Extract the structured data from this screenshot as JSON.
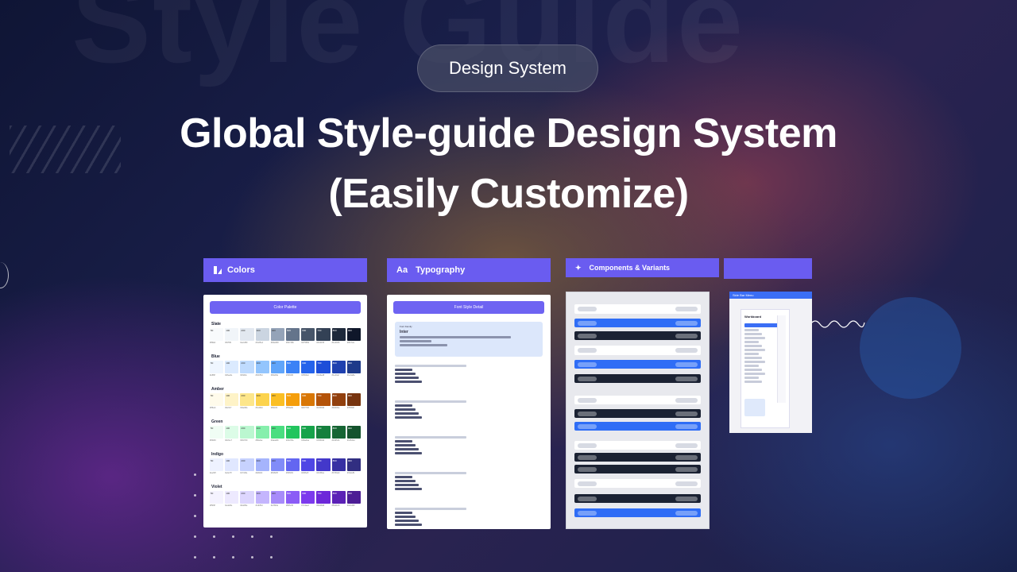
{
  "background_word": "Style Guide",
  "badge": {
    "label": "Design System"
  },
  "headline": {
    "line1": "Global Style-guide Design System",
    "line2": "(Easily Customize)"
  },
  "tabs": [
    {
      "label": "Colors",
      "icon": "palette-icon"
    },
    {
      "label": "Typography",
      "icon": "typography-icon",
      "icon_text": "Aa"
    },
    {
      "label": "Components & Variants",
      "icon": "components-icon"
    },
    {
      "label": "",
      "icon": ""
    }
  ],
  "colors_card": {
    "header": "Color Palette",
    "groups": [
      {
        "name": "Slate",
        "steps": [
          "50",
          "100",
          "200",
          "300",
          "400",
          "500",
          "600",
          "700",
          "800",
          "900"
        ],
        "colors": [
          "#f8fafc",
          "#f1f5f9",
          "#e2e8f0",
          "#cbd5e1",
          "#94a3b8",
          "#64748b",
          "#475569",
          "#334155",
          "#1e293b",
          "#0f172a"
        ]
      },
      {
        "name": "Blue",
        "steps": [
          "50",
          "100",
          "200",
          "300",
          "400",
          "500",
          "600",
          "700",
          "800",
          "900"
        ],
        "colors": [
          "#eff6ff",
          "#dbeafe",
          "#bfdbfe",
          "#93c5fd",
          "#60a5fa",
          "#3b82f6",
          "#2563eb",
          "#1d4ed8",
          "#1e40af",
          "#1e3a8a"
        ]
      },
      {
        "name": "Amber",
        "steps": [
          "50",
          "100",
          "200",
          "300",
          "400",
          "500",
          "600",
          "700",
          "800",
          "900"
        ],
        "colors": [
          "#fffbeb",
          "#fef3c7",
          "#fde68a",
          "#fcd34d",
          "#fbbf24",
          "#f59e0b",
          "#d97706",
          "#b45309",
          "#92400e",
          "#78350f"
        ]
      },
      {
        "name": "Green",
        "steps": [
          "50",
          "100",
          "200",
          "300",
          "400",
          "500",
          "600",
          "700",
          "800",
          "900"
        ],
        "colors": [
          "#f0fdf4",
          "#dcfce7",
          "#bbf7d0",
          "#86efac",
          "#4ade80",
          "#22c55e",
          "#16a34a",
          "#15803d",
          "#166534",
          "#14532d"
        ]
      },
      {
        "name": "Indigo",
        "steps": [
          "50",
          "100",
          "200",
          "300",
          "400",
          "500",
          "600",
          "700",
          "800",
          "900"
        ],
        "colors": [
          "#eef2ff",
          "#e0e7ff",
          "#c7d2fe",
          "#a5b4fc",
          "#818cf8",
          "#6366f1",
          "#4f46e5",
          "#4338ca",
          "#3730a3",
          "#312e81"
        ]
      },
      {
        "name": "Violet",
        "steps": [
          "50",
          "100",
          "200",
          "300",
          "400",
          "500",
          "600",
          "700",
          "800",
          "900"
        ],
        "colors": [
          "#f5f3ff",
          "#ede9fe",
          "#ddd6fe",
          "#c4b5fd",
          "#a78bfa",
          "#8b5cf6",
          "#7c3aed",
          "#6d28d9",
          "#5b21b6",
          "#4c1d95"
        ]
      }
    ]
  },
  "typography_card": {
    "header": "Font Style Detail",
    "font_family_label": "Font Family",
    "font_name": "Inter"
  },
  "sidebar_card": {
    "header": "Side Bar Menu",
    "logo": "Workboard"
  },
  "accent": "#6a5cf0"
}
